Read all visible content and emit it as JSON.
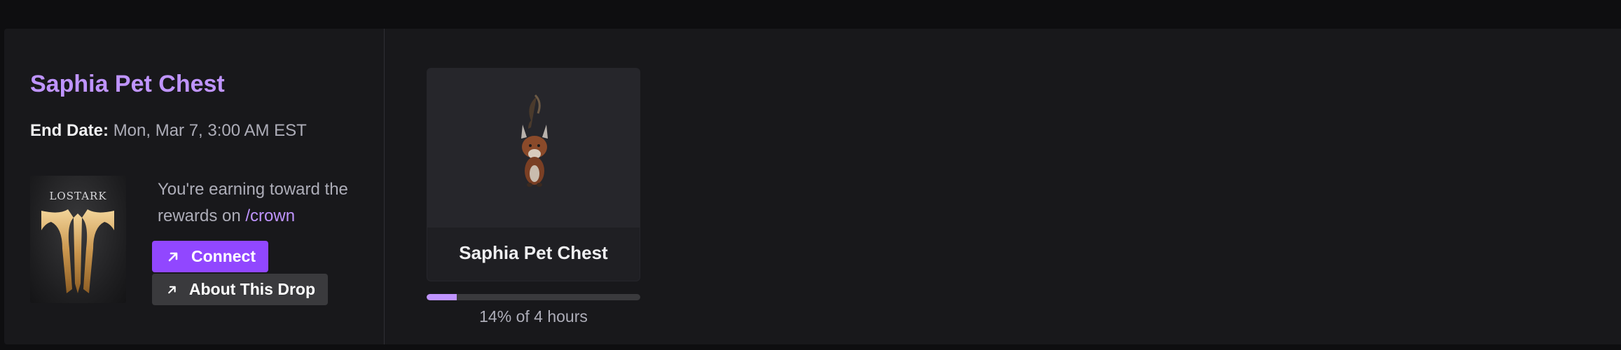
{
  "campaign": {
    "title": "Saphia Pet Chest",
    "end_date_label": "End Date:",
    "end_date_value": "Mon, Mar 7, 3:00 AM EST"
  },
  "game": {
    "logo_text": "LOSTARK",
    "logo_icon": "lost-ark-logo"
  },
  "earning": {
    "text": "You're earning toward the rewards on ",
    "channel_link": "/crown"
  },
  "buttons": {
    "connect_label": "Connect",
    "about_label": "About This Drop",
    "icon": "external-arrow-icon"
  },
  "reward": {
    "name": "Saphia Pet Chest",
    "image_icon": "fox-pet-image"
  },
  "progress": {
    "fraction": 0.14,
    "label": "14% of 4 hours"
  },
  "colors": {
    "accent": "#bf94ff",
    "button_primary": "#9147ff",
    "button_secondary": "#3a3a3d",
    "card_bg": "#18181b",
    "page_bg": "#0e0e10"
  }
}
